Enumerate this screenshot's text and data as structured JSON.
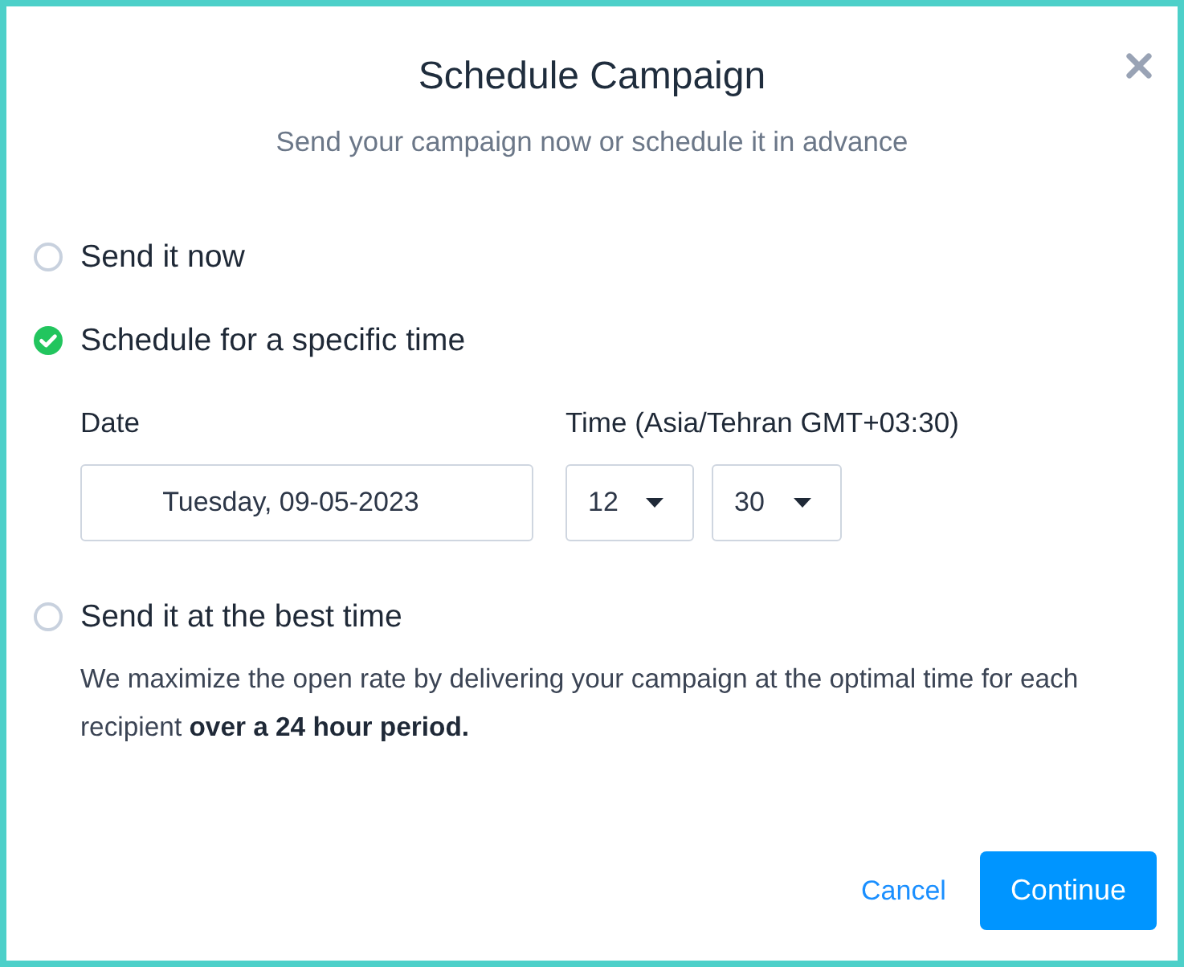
{
  "dialog": {
    "title": "Schedule Campaign",
    "subtitle": "Send your campaign now or schedule it in advance"
  },
  "options": [
    {
      "label": "Send it now",
      "selected": false
    },
    {
      "label": "Schedule for a specific time",
      "selected": true,
      "date": {
        "label": "Date",
        "value": "Tuesday, 09-05-2023"
      },
      "time": {
        "label": "Time (Asia/Tehran GMT+03:30)",
        "hour": "12",
        "minute": "30"
      }
    },
    {
      "label": "Send it at the best time",
      "selected": false,
      "description": "We maximize the open rate by delivering your campaign at the optimal time for each recipient **over a 24 hour period.**"
    }
  ],
  "buttons": [
    {
      "kind": "link",
      "label": "Cancel"
    },
    {
      "kind": "primary",
      "label": "Continue"
    }
  ]
}
